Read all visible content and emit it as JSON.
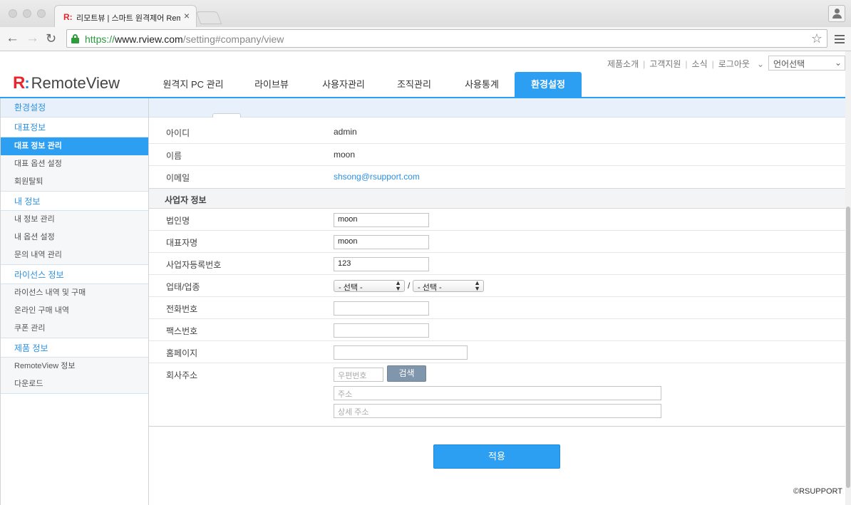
{
  "browser": {
    "tab_title": "리모트뷰 | 스마트 원격제어 RemoteView",
    "tab_favicon": "R:",
    "tab_close": "×",
    "url_scheme": "https://",
    "url_host": "www.rview.com",
    "url_path": "/setting#company/view",
    "icons": [
      "back-arrow-icon",
      "forward-arrow-icon",
      "reload-icon",
      "lock-icon",
      "star-icon",
      "menu-icon",
      "profile-icon"
    ]
  },
  "header": {
    "util_links": [
      "제품소개",
      "고객지원",
      "소식",
      "로그아웃"
    ],
    "language_select": "언어선택",
    "logo_mark": "R",
    "logo_colon": ":",
    "logo_text": "RemoteView",
    "nav": [
      {
        "label": "원격지 PC 관리",
        "active": false
      },
      {
        "label": "라이브뷰",
        "active": false
      },
      {
        "label": "사용자관리",
        "active": false
      },
      {
        "label": "조직관리",
        "active": false
      },
      {
        "label": "사용통계",
        "active": false
      },
      {
        "label": "환경설정",
        "active": true
      }
    ],
    "accent_color": "#2d9ff2"
  },
  "sidebar": {
    "title": "환경설정",
    "groups": [
      {
        "label": "대표정보",
        "items": [
          "대표 정보 관리",
          "대표 옵션 설정",
          "회원탈퇴"
        ]
      },
      {
        "label": "내 정보",
        "items": [
          "내 정보 관리",
          "내 옵션 설정",
          "문의 내역 관리"
        ]
      },
      {
        "label": "라이선스 정보",
        "items": [
          "라이선스 내역 및 구매",
          "온라인 구매 내역",
          "쿠폰 관리"
        ]
      },
      {
        "label": "제품 정보",
        "items": [
          "RemoteView 정보",
          "다운로드"
        ]
      }
    ],
    "active_item": "대표 정보 관리"
  },
  "account": {
    "id_label": "아이디",
    "id_value": "admin",
    "name_label": "이름",
    "name_value": "moon",
    "email_label": "이메일",
    "email_value": "shsong@rsupport.com"
  },
  "business": {
    "section_title": "사업자 정보",
    "corp_label": "법인명",
    "corp_value": "moon",
    "ceo_label": "대표자명",
    "ceo_value": "moon",
    "regno_label": "사업자등록번호",
    "regno_value": "123",
    "type_label": "업태/업종",
    "type_select_1": "- 선택 -",
    "type_slash": "/",
    "type_select_2": "- 선택 -",
    "phone_label": "전화번호",
    "phone_value": "",
    "fax_label": "팩스번호",
    "fax_value": "",
    "homepage_label": "홈페이지",
    "homepage_value": "",
    "address_label": "회사주소",
    "zip_placeholder": "우편번호",
    "search_button": "검색",
    "address_placeholder": "주소",
    "address_detail_placeholder": "상세 주소"
  },
  "apply_button": "적용",
  "copyright": "©RSUPPORT"
}
